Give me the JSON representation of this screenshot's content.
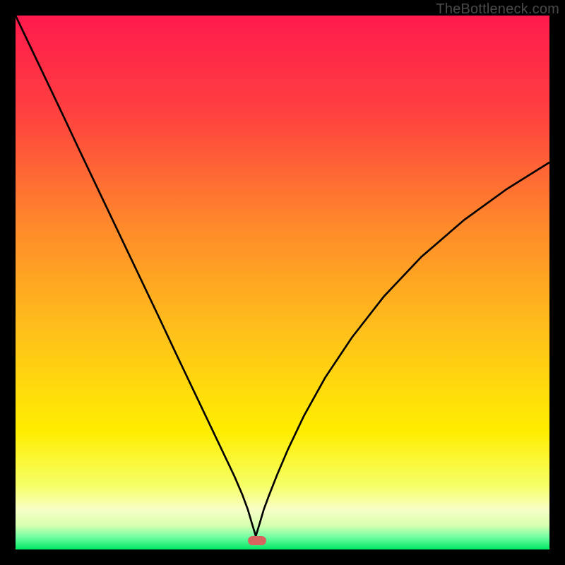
{
  "watermark": {
    "text": "TheBottleneck.com"
  },
  "colors": {
    "frame": "#000000",
    "curve": "#000000",
    "pill": "#d9635e",
    "gradient_stops": [
      {
        "pos": 0.0,
        "color": "#ff1a4d"
      },
      {
        "pos": 0.18,
        "color": "#ff4040"
      },
      {
        "pos": 0.4,
        "color": "#ff8b2a"
      },
      {
        "pos": 0.6,
        "color": "#ffc21a"
      },
      {
        "pos": 0.78,
        "color": "#ffee00"
      },
      {
        "pos": 0.88,
        "color": "#f6ff66"
      },
      {
        "pos": 0.925,
        "color": "#f8ffc6"
      },
      {
        "pos": 0.955,
        "color": "#d7ffb0"
      },
      {
        "pos": 0.975,
        "color": "#7affa5"
      },
      {
        "pos": 1.0,
        "color": "#00e865"
      }
    ]
  },
  "pill": {
    "x_norm": 0.435,
    "y_norm": 0.975,
    "w_norm": 0.035,
    "h_norm": 0.017
  },
  "chart_data": {
    "type": "line",
    "title": "",
    "xlabel": "",
    "ylabel": "",
    "xlim": [
      0,
      100
    ],
    "ylim": [
      0,
      100
    ],
    "grid": false,
    "legend": false,
    "series": [
      {
        "name": "left-branch",
        "x": [
          0,
          3,
          6,
          9,
          12,
          15,
          18,
          21,
          24,
          27,
          30,
          33,
          36,
          39,
          41,
          42.5,
          43.5,
          44.3,
          45.0
        ],
        "values": [
          100.0,
          93.7,
          87.4,
          81.1,
          74.7,
          68.4,
          62.1,
          55.8,
          49.5,
          43.2,
          36.8,
          30.5,
          24.2,
          17.9,
          13.7,
          10.2,
          7.5,
          4.8,
          2.5
        ]
      },
      {
        "name": "right-branch",
        "x": [
          45.0,
          45.7,
          46.5,
          47.5,
          49,
          51,
          54,
          58,
          63,
          69,
          76,
          84,
          92,
          100
        ],
        "values": [
          2.5,
          4.8,
          7.5,
          10.2,
          14.0,
          18.7,
          25.0,
          32.2,
          39.7,
          47.4,
          54.8,
          61.7,
          67.5,
          72.5
        ]
      }
    ],
    "annotations": [
      {
        "text": "TheBottleneck.com",
        "pos": "top-right"
      }
    ],
    "minimum_marker": {
      "x": 45.0,
      "y": 2.5
    }
  }
}
